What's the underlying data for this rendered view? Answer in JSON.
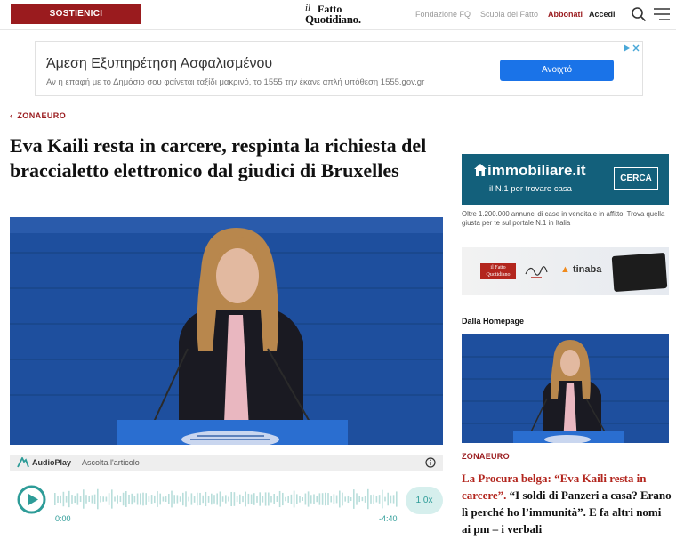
{
  "header": {
    "support_label": "SOSTIENICI",
    "logo": {
      "line1": "il",
      "line2": "Fatto",
      "line3": "Quotidiano."
    },
    "nav": {
      "fondazione": "Fondazione FQ",
      "scuola": "Scuola del Fatto",
      "abbonati": "Abbonati",
      "accedi": "Accedi"
    },
    "icons": {
      "search": "search-icon",
      "menu": "hamburger-menu-icon"
    }
  },
  "ad_banner": {
    "title": "Άμεση Εξυπηρέτηση Ασφαλισμένου",
    "subtitle": "Αν η επαφή με το Δημόσιο σου φαίνεται ταξίδι μακρινό, το 1555 την έκανε απλή υπόθεση 1555.gov.gr",
    "button_label": "Ανοιχτό",
    "button_color": "#1a73e8"
  },
  "article": {
    "breadcrumb": "ZONAEURO",
    "headline": "Eva Kaili resta in carcere, respinta la richiesta del braccialetto elettronico dal giudici di Bruxelles"
  },
  "audio": {
    "brand": "AudioPlay",
    "sub": "· Ascolta l'articolo",
    "time_start": "0:00",
    "time_end": "-4:40",
    "speed": "1.0x",
    "accent_color": "#2e9c98"
  },
  "sidebar": {
    "ad1": {
      "brand": "immobiliare",
      "brand_tld": ".it",
      "tagline": "il N.1 per trovare casa",
      "button": "CERCA",
      "caption": "Oltre 1.200.000 annunci di case in vendita e in affitto. Trova quella giusta per te sul portale N.1 in Italia"
    },
    "ad2": {
      "logo_line1": "il Fatto",
      "logo_line2": "Quotidiano",
      "partner": "tinaba"
    },
    "section_title": "Dalla Homepage",
    "kicker": "ZONAEURO",
    "headline_red": "La Procura belga: “Eva Kaili resta in carcere”.",
    "headline_rest": " “I soldi di Panzeri a casa? Erano lì perché ho l’immunità”. E fa altri nomi ai pm – i verbali"
  },
  "colors": {
    "brand_red": "#9a1b1e",
    "immobiliare_blue": "#13607b",
    "parliament_blue": "#1e4f9e"
  }
}
